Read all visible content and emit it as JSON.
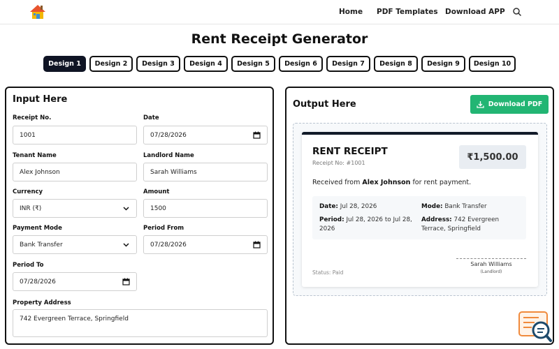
{
  "header": {
    "nav": [
      {
        "label": "Home"
      },
      {
        "label": "PDF Templates"
      },
      {
        "label": "Download APP"
      }
    ]
  },
  "page": {
    "title": "Rent Receipt Generator"
  },
  "tabs": [
    {
      "label": "Design 1",
      "active": true
    },
    {
      "label": "Design 2"
    },
    {
      "label": "Design 3"
    },
    {
      "label": "Design 4"
    },
    {
      "label": "Design 5"
    },
    {
      "label": "Design 6"
    },
    {
      "label": "Design 7"
    },
    {
      "label": "Design 8"
    },
    {
      "label": "Design 9"
    },
    {
      "label": "Design 10"
    }
  ],
  "input": {
    "heading": "Input Here",
    "receipt_no": {
      "label": "Receipt No.",
      "value": "1001"
    },
    "date": {
      "label": "Date",
      "value": "07/28/2026"
    },
    "tenant_name": {
      "label": "Tenant Name",
      "value": "Alex Johnson"
    },
    "landlord_name": {
      "label": "Landlord Name",
      "value": "Sarah Williams"
    },
    "currency": {
      "label": "Currency",
      "value": "INR (₹)"
    },
    "amount": {
      "label": "Amount",
      "value": "1500"
    },
    "payment_mode": {
      "label": "Payment Mode",
      "value": "Bank Transfer"
    },
    "period_from": {
      "label": "Period From",
      "value": "07/28/2026"
    },
    "period_to": {
      "label": "Period To",
      "value": "07/28/2026"
    },
    "property_address": {
      "label": "Property Address",
      "value": "742 Evergreen Terrace, Springfield"
    }
  },
  "output": {
    "heading": "Output Here",
    "download_label": "Download PDF",
    "receipt": {
      "title": "RENT RECEIPT",
      "number": "Receipt No: #1001",
      "amount": "₹1,500.00",
      "received_prefix": "Received from",
      "tenant": "Alex Johnson",
      "received_suffix": "for rent payment.",
      "date_label": "Date:",
      "date_value": "Jul 28, 2026",
      "mode_label": "Mode:",
      "mode_value": "Bank Transfer",
      "period_label": "Period:",
      "period_value_1": "Jul 28, 2026 to Jul 28,",
      "period_value_2": "2026",
      "address_label": "Address:",
      "address_value_1": "742 Evergreen",
      "address_value_2": "Terrace, Springfield",
      "signatory": "Sarah Williams",
      "signatory_role": "(Landlord)",
      "status": "Status: Paid"
    }
  },
  "colors": {
    "tab_active_bg": "#0f1424",
    "download_button": "#22b573",
    "receipt_top_border": "#111a28"
  },
  "icons": [
    "house-logo-icon",
    "search-icon",
    "calendar-icon",
    "chevron-down-icon",
    "download-icon",
    "help-search-icon"
  ]
}
